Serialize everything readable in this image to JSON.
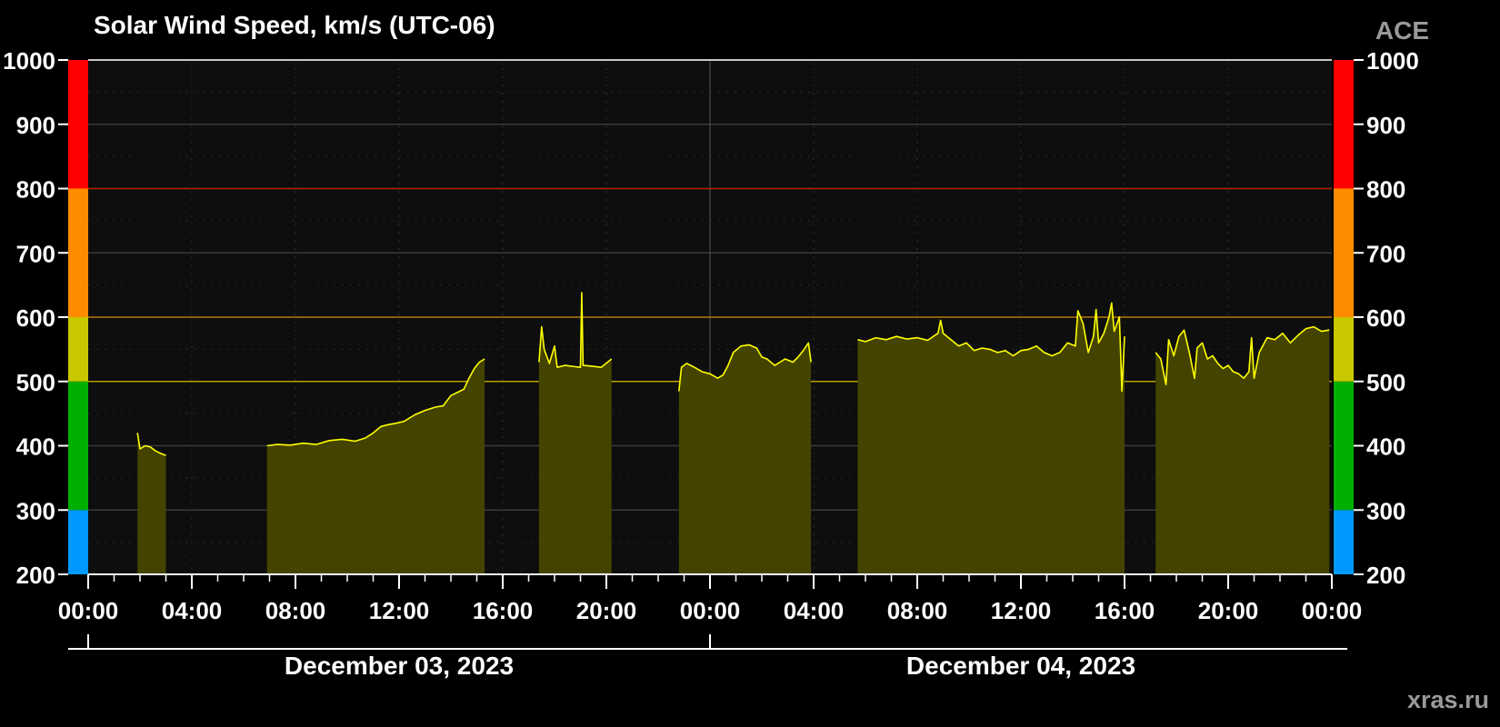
{
  "chart_data": {
    "type": "area",
    "title": "Solar Wind Speed, km/s (UTC-06)",
    "source": "ACE",
    "credit": "xras.ru",
    "ylim": [
      200,
      1000
    ],
    "yticks": [
      "200",
      "300",
      "400",
      "500",
      "600",
      "700",
      "800",
      "900",
      "1000"
    ],
    "xlim_hours": [
      0,
      48
    ],
    "xticks": [
      "00:00",
      "04:00",
      "08:00",
      "12:00",
      "16:00",
      "20:00",
      "00:00",
      "04:00",
      "08:00",
      "12:00",
      "16:00",
      "20:00",
      "00:00"
    ],
    "dates": [
      "December 03, 2023",
      "December 04, 2023"
    ],
    "threshold_lines": [
      {
        "value": 500,
        "color": "#b8a000"
      },
      {
        "value": 600,
        "color": "#b07000"
      },
      {
        "value": 800,
        "color": "#b02000"
      }
    ],
    "level_bands": [
      {
        "from": 200,
        "to": 300,
        "color": "#0099ff"
      },
      {
        "from": 300,
        "to": 500,
        "color": "#00b000"
      },
      {
        "from": 500,
        "to": 600,
        "color": "#c8c800"
      },
      {
        "from": 600,
        "to": 800,
        "color": "#ff8c00"
      },
      {
        "from": 800,
        "to": 1000,
        "color": "#ff0000"
      }
    ],
    "colors": {
      "line": "#ffff00",
      "fill": "#444400",
      "plot_bg": "#0e0e0e",
      "grid": "#3a3a3a"
    },
    "series": [
      {
        "points": [
          [
            1.9,
            420
          ],
          [
            2.0,
            395
          ],
          [
            2.2,
            400
          ],
          [
            2.4,
            398
          ],
          [
            2.6,
            392
          ],
          [
            2.8,
            388
          ],
          [
            3.0,
            385
          ]
        ]
      },
      {
        "points": [
          [
            6.9,
            400
          ],
          [
            7.3,
            402
          ],
          [
            7.8,
            401
          ],
          [
            8.3,
            404
          ],
          [
            8.8,
            402
          ],
          [
            9.3,
            408
          ],
          [
            9.8,
            410
          ],
          [
            10.3,
            407
          ],
          [
            10.7,
            412
          ],
          [
            11.0,
            420
          ],
          [
            11.3,
            430
          ],
          [
            11.6,
            433
          ],
          [
            11.9,
            435
          ],
          [
            12.2,
            438
          ],
          [
            12.6,
            448
          ],
          [
            13.0,
            455
          ],
          [
            13.4,
            460
          ],
          [
            13.7,
            462
          ],
          [
            14.0,
            478
          ],
          [
            14.3,
            484
          ],
          [
            14.5,
            488
          ],
          [
            14.7,
            505
          ],
          [
            14.9,
            520
          ],
          [
            15.1,
            530
          ],
          [
            15.3,
            535
          ]
        ]
      },
      {
        "points": [
          [
            17.4,
            530
          ],
          [
            17.5,
            585
          ],
          [
            17.6,
            550
          ],
          [
            17.8,
            528
          ],
          [
            18.0,
            555
          ],
          [
            18.1,
            522
          ],
          [
            18.4,
            525
          ],
          [
            18.8,
            523
          ],
          [
            19.0,
            522
          ],
          [
            19.05,
            638
          ],
          [
            19.1,
            525
          ],
          [
            19.4,
            524
          ],
          [
            19.8,
            522
          ],
          [
            20.2,
            535
          ]
        ]
      },
      {
        "points": [
          [
            22.8,
            485
          ],
          [
            22.9,
            522
          ],
          [
            23.1,
            528
          ],
          [
            23.4,
            522
          ],
          [
            23.7,
            515
          ],
          [
            24.0,
            512
          ],
          [
            24.3,
            505
          ],
          [
            24.5,
            510
          ],
          [
            24.7,
            525
          ],
          [
            24.9,
            545
          ],
          [
            25.2,
            555
          ],
          [
            25.5,
            557
          ],
          [
            25.8,
            552
          ],
          [
            26.0,
            538
          ],
          [
            26.2,
            535
          ],
          [
            26.5,
            525
          ],
          [
            26.9,
            535
          ],
          [
            27.2,
            530
          ],
          [
            27.4,
            538
          ],
          [
            27.6,
            548
          ],
          [
            27.8,
            560
          ],
          [
            27.9,
            530
          ]
        ]
      },
      {
        "points": [
          [
            29.7,
            565
          ],
          [
            30.0,
            562
          ],
          [
            30.4,
            568
          ],
          [
            30.8,
            565
          ],
          [
            31.2,
            570
          ],
          [
            31.6,
            566
          ],
          [
            32.0,
            568
          ],
          [
            32.4,
            564
          ],
          [
            32.8,
            575
          ],
          [
            32.9,
            595
          ],
          [
            33.0,
            575
          ],
          [
            33.3,
            565
          ],
          [
            33.6,
            555
          ],
          [
            33.9,
            560
          ],
          [
            34.2,
            548
          ],
          [
            34.5,
            552
          ],
          [
            34.8,
            550
          ],
          [
            35.1,
            545
          ],
          [
            35.4,
            548
          ],
          [
            35.7,
            540
          ],
          [
            36.0,
            548
          ],
          [
            36.3,
            550
          ],
          [
            36.6,
            555
          ],
          [
            36.9,
            545
          ],
          [
            37.2,
            540
          ],
          [
            37.5,
            545
          ],
          [
            37.8,
            560
          ],
          [
            38.1,
            555
          ],
          [
            38.2,
            610
          ],
          [
            38.4,
            590
          ],
          [
            38.6,
            545
          ],
          [
            38.8,
            570
          ],
          [
            38.9,
            612
          ],
          [
            39.0,
            560
          ],
          [
            39.2,
            575
          ],
          [
            39.4,
            600
          ],
          [
            39.5,
            622
          ],
          [
            39.6,
            578
          ],
          [
            39.8,
            600
          ],
          [
            39.9,
            485
          ],
          [
            40.0,
            570
          ]
        ]
      },
      {
        "points": [
          [
            41.2,
            545
          ],
          [
            41.4,
            535
          ],
          [
            41.6,
            495
          ],
          [
            41.7,
            565
          ],
          [
            41.9,
            540
          ],
          [
            42.1,
            570
          ],
          [
            42.3,
            580
          ],
          [
            42.5,
            545
          ],
          [
            42.7,
            505
          ],
          [
            42.8,
            552
          ],
          [
            43.0,
            560
          ],
          [
            43.2,
            535
          ],
          [
            43.4,
            540
          ],
          [
            43.6,
            528
          ],
          [
            43.8,
            520
          ],
          [
            44.0,
            525
          ],
          [
            44.2,
            515
          ],
          [
            44.4,
            512
          ],
          [
            44.6,
            505
          ],
          [
            44.8,
            515
          ],
          [
            44.9,
            568
          ],
          [
            45.0,
            505
          ],
          [
            45.2,
            545
          ],
          [
            45.5,
            568
          ],
          [
            45.8,
            565
          ],
          [
            46.1,
            575
          ],
          [
            46.4,
            560
          ],
          [
            46.7,
            572
          ],
          [
            47.0,
            582
          ],
          [
            47.3,
            585
          ],
          [
            47.6,
            578
          ],
          [
            47.9,
            580
          ]
        ]
      }
    ]
  }
}
